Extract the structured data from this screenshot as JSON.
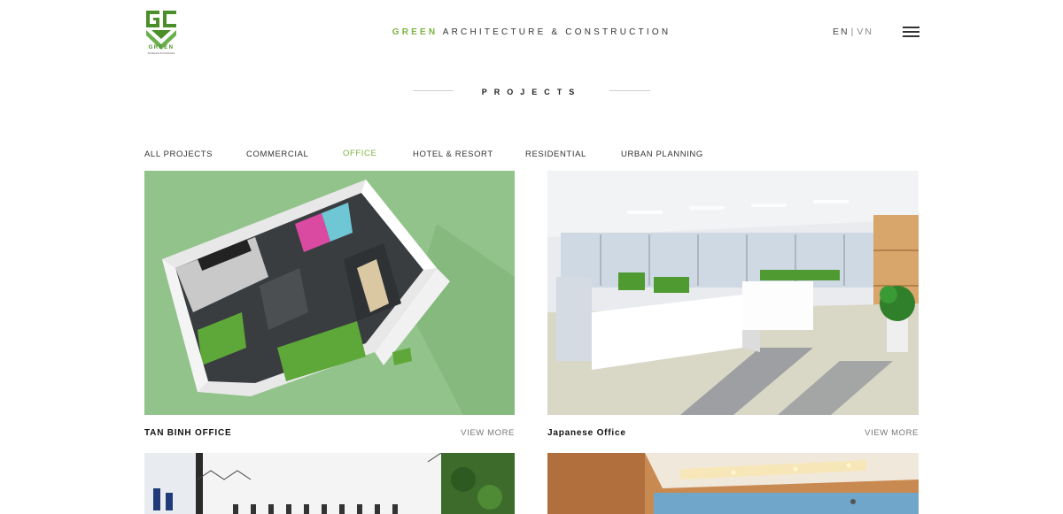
{
  "header": {
    "logo_word": "GREEN",
    "logo_tagline": "Architecture & Construction",
    "brand_highlight": "GREEN",
    "brand_rest": "ARCHITECTURE & CONSTRUCTION",
    "lang_en": "EN",
    "lang_separator": "|",
    "lang_vn": "VN",
    "menu_icon": "hamburger-icon"
  },
  "page": {
    "title": "PROJECTS"
  },
  "filters": [
    {
      "label": "ALL PROJECTS",
      "active": false
    },
    {
      "label": "COMMERCIAL",
      "active": false
    },
    {
      "label": "OFFICE",
      "active": true
    },
    {
      "label": "HOTEL & RESORT",
      "active": false
    },
    {
      "label": "RESIDENTIAL",
      "active": false
    },
    {
      "label": "URBAN PLANNING",
      "active": false
    }
  ],
  "projects": [
    {
      "title": "TAN BINH OFFICE",
      "link": "VIEW MORE"
    },
    {
      "title": "Japanese Office",
      "link": "VIEW MORE"
    }
  ],
  "colors": {
    "accent": "#7cb342",
    "logo_green": "#4a8f2a"
  }
}
